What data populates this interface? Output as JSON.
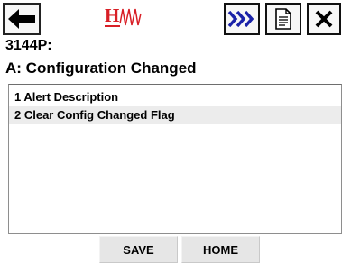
{
  "toolbar": {
    "back_icon": "left-arrow-icon",
    "logo_text": "H",
    "logo_icon": "hart-waveform-icon",
    "multi_icon": "triple-chevron-right-icon",
    "doc_icon": "document-icon",
    "close_icon": "close-x-icon",
    "colors": {
      "logo": "#d81f26",
      "multi_arrows": "#1a22a8"
    }
  },
  "header": {
    "device_tag": "3144P:",
    "title": "A: Configuration Changed"
  },
  "menu": {
    "items": [
      {
        "label": "1 Alert Description"
      },
      {
        "label": "2 Clear Config Changed Flag"
      }
    ]
  },
  "footer": {
    "save_label": "SAVE",
    "home_label": "HOME"
  }
}
